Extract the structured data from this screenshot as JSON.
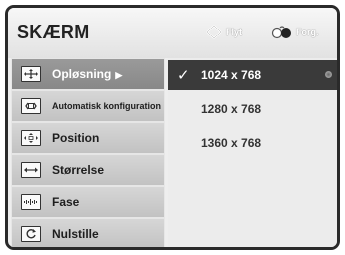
{
  "header": {
    "title": "SKÆRM",
    "hint_move": "Flyt",
    "hint_back": "Forg."
  },
  "menu": {
    "items": [
      {
        "label": "Opløsning",
        "selected": true,
        "icon": "move-arrows-icon"
      },
      {
        "label": "Automatisk konfiguration",
        "selected": false,
        "icon": "auto-config-icon"
      },
      {
        "label": "Position",
        "selected": false,
        "icon": "position-arrows-icon"
      },
      {
        "label": "Størrelse",
        "selected": false,
        "icon": "size-arrows-icon"
      },
      {
        "label": "Fase",
        "selected": false,
        "icon": "phase-icon"
      },
      {
        "label": "Nulstille",
        "selected": false,
        "icon": "reset-icon"
      }
    ],
    "arrow": "▶"
  },
  "options": {
    "check": "✓",
    "items": [
      {
        "value": "1024 x 768",
        "selected": true
      },
      {
        "value": "1280 x 768",
        "selected": false
      },
      {
        "value": "1360 x 768",
        "selected": false
      }
    ]
  },
  "colors": {
    "selected_menu_bg": "#8f8f8f",
    "selected_option_bg": "#3a3a3a",
    "frame": "#2a2a2a"
  }
}
